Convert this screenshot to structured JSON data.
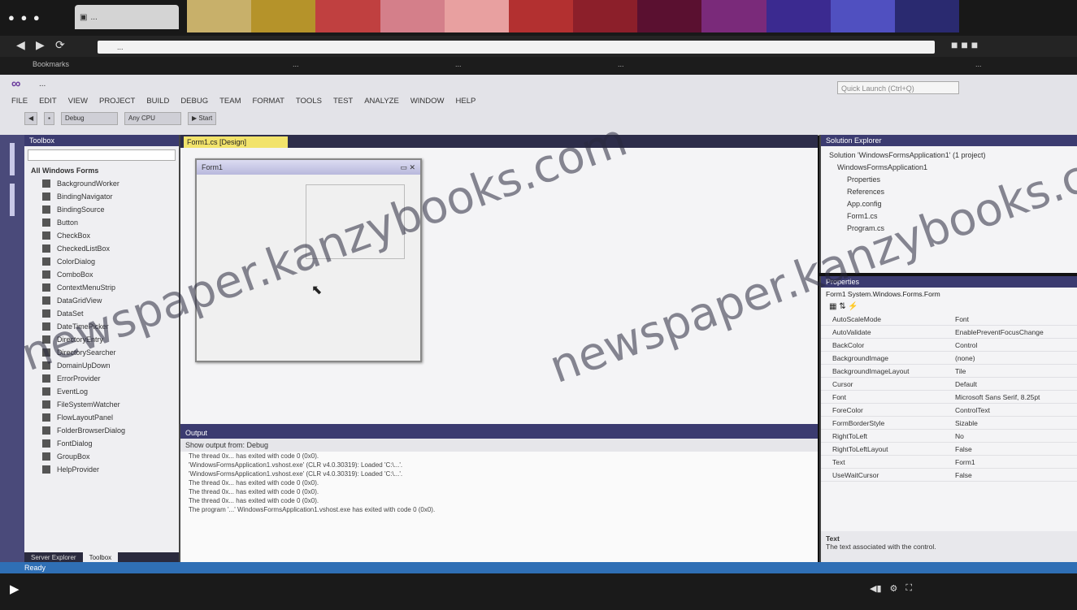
{
  "browser": {
    "tab_title": "...",
    "address": "...",
    "bookmarks": [
      "Bookmarks",
      "...",
      "...",
      "...",
      "..."
    ],
    "collage_colors": [
      "#c8b06a",
      "#b5932a",
      "#c04040",
      "#d47f8a",
      "#e8a0a0",
      "#b33030",
      "#8c1f2a",
      "#5a1030",
      "#7a2a7a",
      "#3b2a90",
      "#5050c0",
      "#2a2a70"
    ]
  },
  "vs": {
    "title": "...",
    "menu": [
      "FILE",
      "EDIT",
      "VIEW",
      "PROJECT",
      "BUILD",
      "DEBUG",
      "TEAM",
      "FORMAT",
      "TOOLS",
      "TEST",
      "ANALYZE",
      "WINDOW",
      "HELP"
    ],
    "toolbar": [
      "Debug",
      "Any CPU",
      "Start"
    ],
    "quick_launch": "Quick Launch (Ctrl+Q)"
  },
  "toolbox": {
    "title": "Toolbox",
    "group": "All Windows Forms",
    "items": [
      "BackgroundWorker",
      "BindingNavigator",
      "BindingSource",
      "Button",
      "CheckBox",
      "CheckedListBox",
      "ColorDialog",
      "ComboBox",
      "ContextMenuStrip",
      "DataGridView",
      "DataSet",
      "DateTimePicker",
      "DirectoryEntry",
      "DirectorySearcher",
      "DomainUpDown",
      "ErrorProvider",
      "EventLog",
      "FileSystemWatcher",
      "FlowLayoutPanel",
      "FolderBrowserDialog",
      "FontDialog",
      "GroupBox",
      "HelpProvider"
    ],
    "bottom_tabs": [
      "Server Explorer",
      "Toolbox"
    ]
  },
  "designer": {
    "tab": "Form1.cs [Design]",
    "form_title": "Form1"
  },
  "output": {
    "title": "Output",
    "source": "Show output from: Debug",
    "lines": [
      "The thread 0x... has exited with code 0 (0x0).",
      "'WindowsFormsApplication1.vshost.exe' (CLR v4.0.30319): Loaded 'C:\\...'.",
      "'WindowsFormsApplication1.vshost.exe' (CLR v4.0.30319): Loaded 'C:\\...'.",
      "The thread 0x... has exited with code 0 (0x0).",
      "The thread 0x... has exited with code 0 (0x0).",
      "The thread 0x... has exited with code 0 (0x0).",
      "The program '...' WindowsFormsApplication1.vshost.exe has exited with code 0 (0x0)."
    ]
  },
  "solution": {
    "title": "Solution Explorer",
    "tree": [
      "Solution 'WindowsFormsApplication1' (1 project)",
      "WindowsFormsApplication1",
      "Properties",
      "References",
      "App.config",
      "Form1.cs",
      "Program.cs"
    ]
  },
  "properties": {
    "title": "Properties",
    "object": "Form1 System.Windows.Forms.Form",
    "rows": [
      {
        "k": "AutoScaleMode",
        "v": "Font"
      },
      {
        "k": "AutoValidate",
        "v": "EnablePreventFocusChange"
      },
      {
        "k": "BackColor",
        "v": "Control"
      },
      {
        "k": "BackgroundImage",
        "v": "(none)"
      },
      {
        "k": "BackgroundImageLayout",
        "v": "Tile"
      },
      {
        "k": "Cursor",
        "v": "Default"
      },
      {
        "k": "Font",
        "v": "Microsoft Sans Serif, 8.25pt"
      },
      {
        "k": "ForeColor",
        "v": "ControlText"
      },
      {
        "k": "FormBorderStyle",
        "v": "Sizable"
      },
      {
        "k": "RightToLeft",
        "v": "No"
      },
      {
        "k": "RightToLeftLayout",
        "v": "False"
      },
      {
        "k": "Text",
        "v": "Form1"
      },
      {
        "k": "UseWaitCursor",
        "v": "False"
      }
    ],
    "desc_title": "Text",
    "desc": "The text associated with the control."
  },
  "status": "Ready",
  "watermark": [
    "newspaper.kanzybooks.com",
    "newspaper.kanzybooks.com"
  ]
}
